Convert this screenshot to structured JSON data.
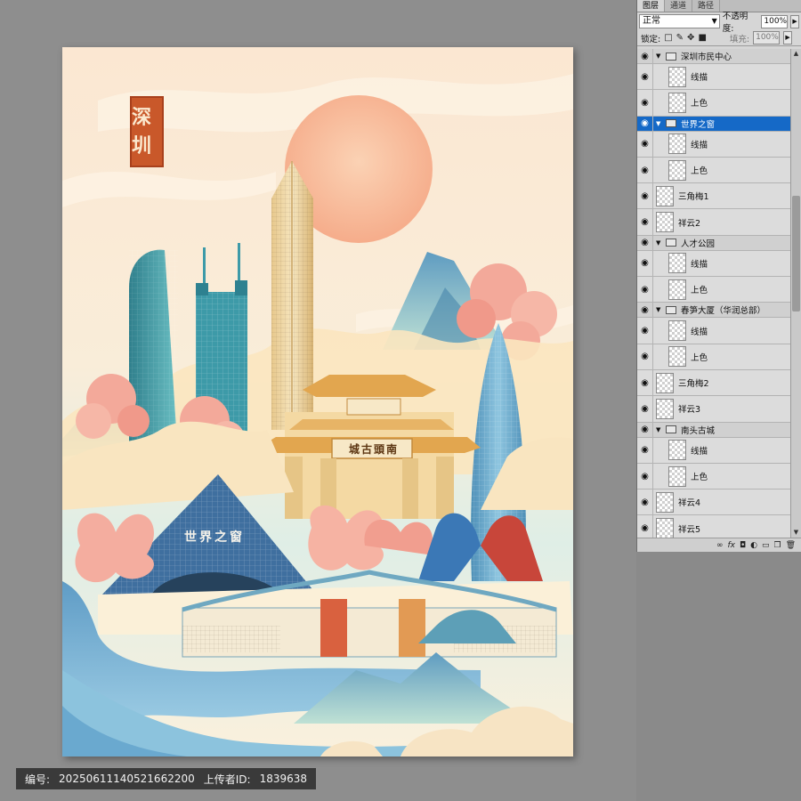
{
  "artwork": {
    "seal_text": "深圳",
    "gate_sign": "城古頭南",
    "pyramid_sign": "世界之窗"
  },
  "panel": {
    "tabs": [
      "图层",
      "通道",
      "路径"
    ],
    "blend_mode": "正常",
    "opacity_label": "不透明度:",
    "opacity_value": "100%",
    "lock_label": "锁定:",
    "fill_label": "填充:",
    "fill_value": "100%",
    "layers": [
      {
        "name": "深圳市民中心",
        "kind": "group"
      },
      {
        "name": "线描",
        "kind": "child"
      },
      {
        "name": "上色",
        "kind": "child"
      },
      {
        "name": "世界之窗",
        "kind": "group",
        "selected": true
      },
      {
        "name": "线描",
        "kind": "child"
      },
      {
        "name": "上色",
        "kind": "child"
      },
      {
        "name": "三角梅1",
        "kind": "layer"
      },
      {
        "name": "祥云2",
        "kind": "layer"
      },
      {
        "name": "人才公园",
        "kind": "group"
      },
      {
        "name": "线描",
        "kind": "child"
      },
      {
        "name": "上色",
        "kind": "child"
      },
      {
        "name": "春笋大厦（华润总部）",
        "kind": "group"
      },
      {
        "name": "线描",
        "kind": "child"
      },
      {
        "name": "上色",
        "kind": "child"
      },
      {
        "name": "三角梅2",
        "kind": "layer"
      },
      {
        "name": "祥云3",
        "kind": "layer"
      },
      {
        "name": "南头古城",
        "kind": "group"
      },
      {
        "name": "线描",
        "kind": "child"
      },
      {
        "name": "上色",
        "kind": "child"
      },
      {
        "name": "祥云4",
        "kind": "layer"
      },
      {
        "name": "祥云5",
        "kind": "layer"
      }
    ],
    "footer_icons": [
      "link-icon",
      "fx-icon",
      "mask-icon",
      "adjustment-icon",
      "new-group-icon",
      "new-layer-icon",
      "trash-icon"
    ]
  },
  "watermark": {
    "id_label": "编号:",
    "id_value": "20250611140521662200",
    "uploader_label": "上传者ID:",
    "uploader_value": "1839638"
  },
  "colors": {
    "selected_layer": "#1569c7",
    "seal": "#c9582a",
    "sun": "#f7b89a"
  }
}
